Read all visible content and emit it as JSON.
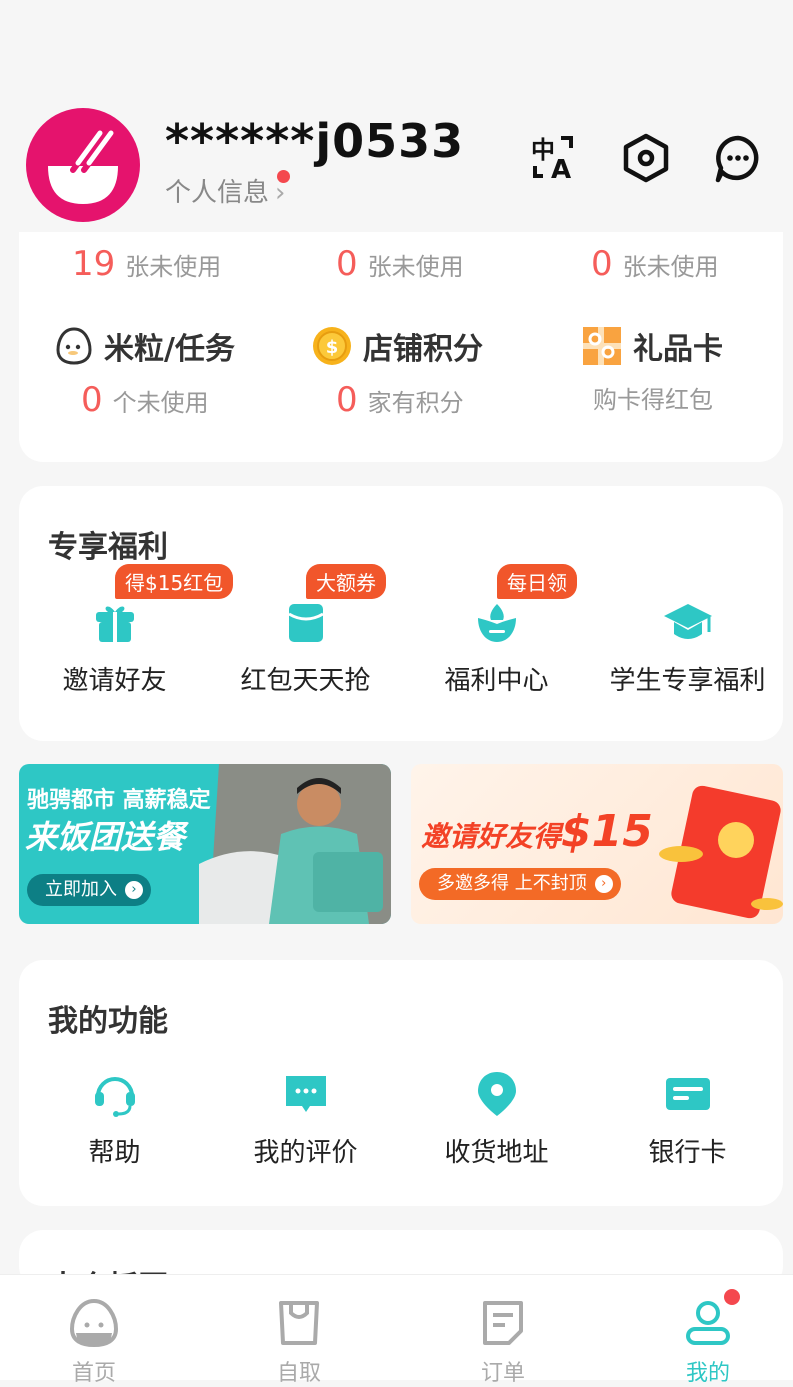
{
  "profile": {
    "username": "******j0533",
    "info_label": "个人信息",
    "info_arrow": "›"
  },
  "header_icons": [
    "translate-icon",
    "settings-icon",
    "message-icon"
  ],
  "assets": {
    "unused_row": [
      {
        "count": "19",
        "label": "张未使用"
      },
      {
        "count": "0",
        "label": "张未使用"
      },
      {
        "count": "0",
        "label": "张未使用"
      }
    ],
    "items": [
      {
        "name": "米粒/任务",
        "icon": "rice-icon",
        "count": "0",
        "sub": "个未使用"
      },
      {
        "name": "店铺积分",
        "icon": "coin-icon",
        "count": "0",
        "sub": "家有积分"
      },
      {
        "name": "礼品卡",
        "icon": "gift-card-icon",
        "count": "",
        "sub": "购卡得红包"
      }
    ]
  },
  "benefits": {
    "title": "专享福利",
    "items": [
      {
        "label": "邀请好友",
        "tag": "得$15红包",
        "icon": "gift-icon"
      },
      {
        "label": "红包天天抢",
        "tag": "大额券",
        "icon": "red-envelope-icon"
      },
      {
        "label": "福利中心",
        "tag": "每日领",
        "icon": "lotus-icon"
      },
      {
        "label": "学生专享福利",
        "tag": "",
        "icon": "graduation-cap-icon"
      }
    ]
  },
  "banners": [
    {
      "line1": "驰骋都市 高薪稳定",
      "line2": "来饭团送餐",
      "button": "立即加入"
    },
    {
      "line1": "邀请好友得",
      "amount": "$15",
      "button": "多邀多得 上不封顶"
    }
  ],
  "functions": {
    "title": "我的功能",
    "items": [
      {
        "label": "帮助",
        "icon": "headset-icon"
      },
      {
        "label": "我的评价",
        "icon": "comment-icon"
      },
      {
        "label": "收货地址",
        "icon": "location-icon"
      },
      {
        "label": "银行卡",
        "icon": "bank-card-icon"
      }
    ]
  },
  "next_section": {
    "title": "大众板区"
  },
  "tabs": [
    {
      "label": "首页",
      "icon": "home-icon"
    },
    {
      "label": "自取",
      "icon": "pickup-bag-icon"
    },
    {
      "label": "订单",
      "icon": "order-icon"
    },
    {
      "label": "我的",
      "icon": "profile-icon",
      "active": true
    }
  ],
  "colors": {
    "accent": "#2ec7c5",
    "brand": "#e5136d",
    "highlight": "#f55d5a",
    "tag": "#f1562b"
  }
}
